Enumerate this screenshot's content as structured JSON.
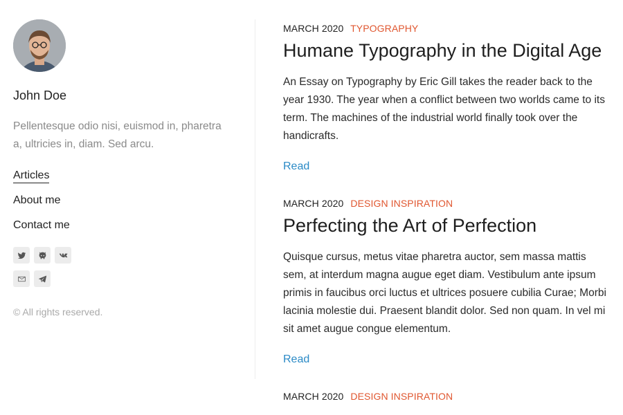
{
  "author": {
    "name": "John Doe",
    "bio": "Pellentesque odio nisi, euismod in, pharetra a, ultricies in, diam. Sed arcu."
  },
  "nav": {
    "items": [
      {
        "label": "Articles",
        "active": true
      },
      {
        "label": "About me",
        "active": false
      },
      {
        "label": "Contact me",
        "active": false
      }
    ]
  },
  "social": [
    "twitter-icon",
    "github-icon",
    "vk-icon",
    "mail-icon",
    "telegram-icon"
  ],
  "copyright": "© All rights reserved.",
  "articles": [
    {
      "date": "MARCH 2020",
      "category": "TYPOGRAPHY",
      "title": "Humane Typography in the Digital Age",
      "excerpt": "An Essay on Typography by Eric Gill takes the reader back to the year 1930. The year when a conflict between two worlds came to its term. The machines of the industrial world finally took over the handicrafts.",
      "read_label": "Read"
    },
    {
      "date": "MARCH 2020",
      "category": "DESIGN INSPIRATION",
      "title": "Perfecting the Art of Perfection",
      "excerpt": "Quisque cursus, metus vitae pharetra auctor, sem massa mattis sem, at interdum magna augue eget diam. Vestibulum ante ipsum primis in faucibus orci luctus et ultrices posuere cubilia Curae; Morbi lacinia molestie dui. Praesent blandit dolor. Sed non quam. In vel mi sit amet augue congue elementum.",
      "read_label": "Read"
    },
    {
      "date": "MARCH 2020",
      "category": "DESIGN INSPIRATION"
    }
  ],
  "colors": {
    "accent": "#e0562f",
    "link": "#2b8ac6",
    "muted": "#8a8a8a"
  }
}
